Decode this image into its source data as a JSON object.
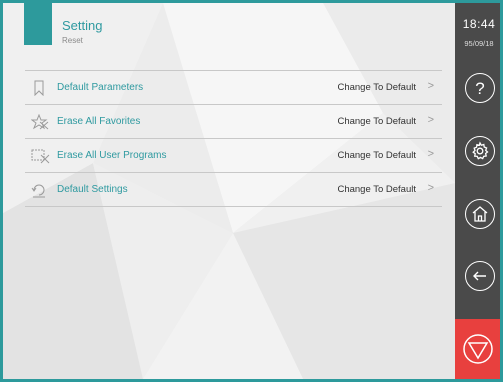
{
  "header": {
    "title": "Setting",
    "subtitle": "Reset"
  },
  "rows": [
    {
      "icon": "bookmark-icon",
      "label": "Default Parameters",
      "action": "Change To Default"
    },
    {
      "icon": "erase-star-icon",
      "label": "Erase All Favorites",
      "action": "Change To Default"
    },
    {
      "icon": "erase-program-icon",
      "label": "Erase All User Programs",
      "action": "Change To Default"
    },
    {
      "icon": "settings-reset-icon",
      "label": "Default Settings",
      "action": "Change To Default"
    }
  ],
  "status": {
    "time": "18:44",
    "date": "95/09/18"
  },
  "sidebar": {
    "buttons": [
      "help-icon",
      "gear-icon",
      "home-icon",
      "back-icon",
      "stop-icon"
    ]
  },
  "colors": {
    "accent": "#2d9a9c",
    "sidebar": "#4a4a4a",
    "stop": "#e8403e"
  }
}
